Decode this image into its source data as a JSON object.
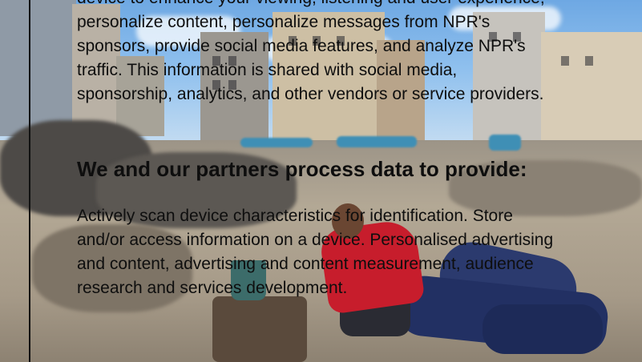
{
  "consent": {
    "intro_lines": [
      "device to enhance your viewing, listening and user experience,",
      "personalize content, personalize messages from NPR's",
      "sponsors, provide social media features, and analyze NPR's",
      "traffic. This information is shared with social media,",
      "sponsorship, analytics, and other vendors or service providers."
    ],
    "heading": "We and our partners process data to provide:",
    "purposes_lines": [
      "Actively scan device characteristics for identification. Store",
      "and/or access information on a device. Personalised advertising",
      "and content, advertising and content measurement, audience",
      "research and services development."
    ]
  },
  "colors": {
    "text": "#0e0e0e",
    "divider": "#111111",
    "sofa": "#2b3a6e",
    "shirt": "#c71d2c",
    "sky": "#6ea8e3"
  }
}
